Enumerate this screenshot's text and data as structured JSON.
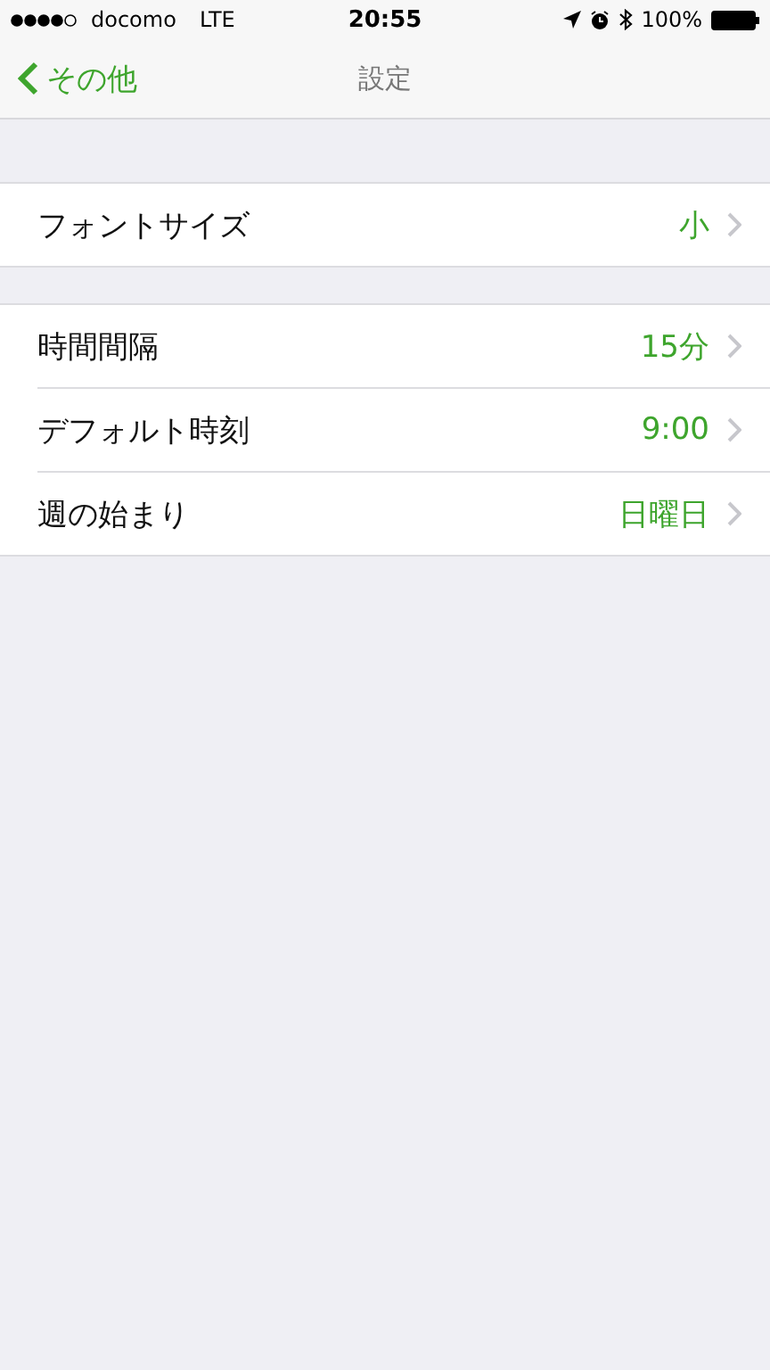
{
  "status_bar": {
    "carrier": "docomo",
    "network": "LTE",
    "time": "20:55",
    "battery": "100%"
  },
  "nav_bar": {
    "back": "その他",
    "title": "設定"
  },
  "groups": [
    {
      "rows": [
        {
          "label": "フォントサイズ",
          "value": "小"
        }
      ]
    },
    {
      "rows": [
        {
          "label": "時間間隔",
          "value": "15分"
        },
        {
          "label": "デフォルト時刻",
          "value": "9:00"
        },
        {
          "label": "週の始まり",
          "value": "日曜日"
        }
      ]
    }
  ]
}
